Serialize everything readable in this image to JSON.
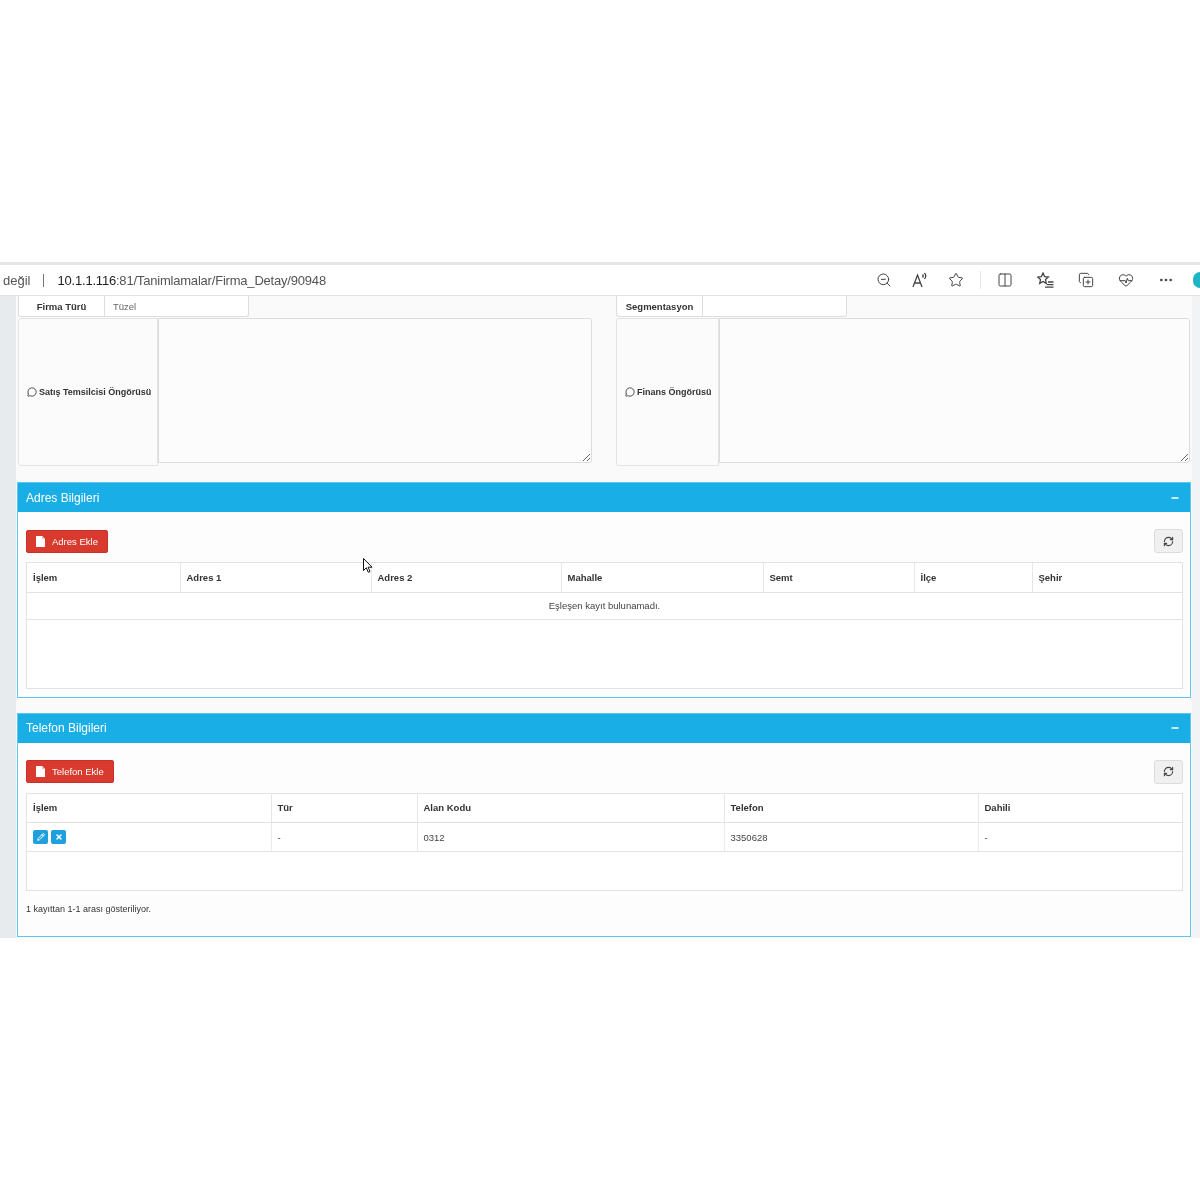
{
  "browser": {
    "security_label": "değil",
    "url_host": "10.1.1.116",
    "url_path": ":81/Tanimlamalar/Firma_Detay/90948"
  },
  "form": [
    {
      "field_label": "Firma Türü",
      "field_value": "Tüzel",
      "note_label": "Satış Temsilcisi Öngörüsü"
    },
    {
      "field_label": "Segmentasyon",
      "note_label": "Finans Öngörüsü"
    }
  ],
  "panels": [
    {
      "title": "Adres Bilgileri",
      "add_button": "Adres Ekle",
      "columns": [
        "İşlem",
        "Adres 1",
        "Adres 2",
        "Mahalle",
        "Semt",
        "İlçe",
        "Şehir"
      ],
      "empty_message": "Eşleşen kayıt bulunamadı."
    },
    {
      "title": "Telefon Bilgileri",
      "add_button": "Telefon Ekle",
      "columns": [
        "İşlem",
        "Tür",
        "Alan Kodu",
        "Telefon",
        "Dahili"
      ],
      "rows": [
        {
          "actions": [
            {
              "kind": "edit"
            },
            {
              "kind": "delete"
            }
          ],
          "cells": [
            "",
            "-",
            "0312",
            "3350628",
            "-"
          ]
        }
      ],
      "summary": "1 kayıttan 1-1 arası gösteriliyor."
    }
  ]
}
